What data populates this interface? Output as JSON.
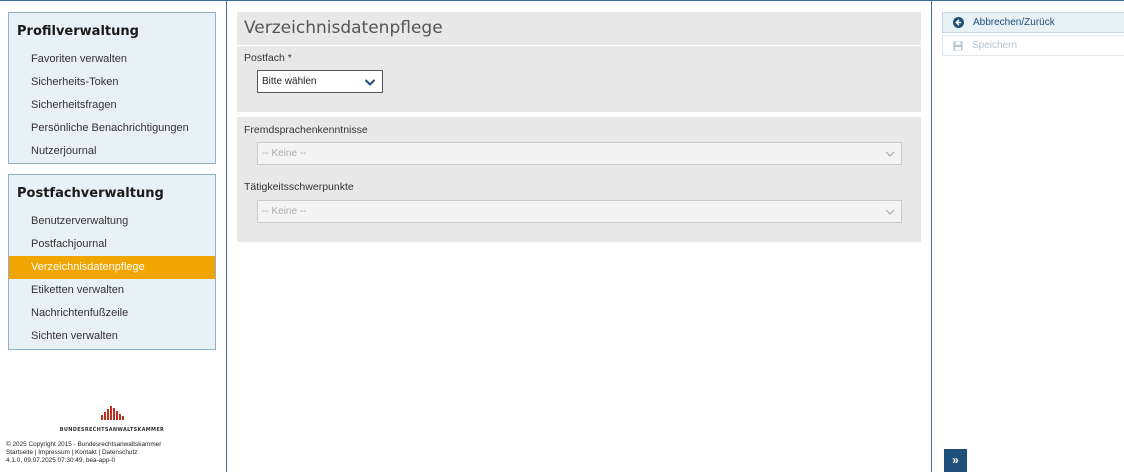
{
  "sidebar": {
    "profile": {
      "title": "Profilverwaltung",
      "items": [
        {
          "label": "Favoriten verwalten"
        },
        {
          "label": "Sicherheits-Token"
        },
        {
          "label": "Sicherheitsfragen"
        },
        {
          "label": "Persönliche Benachrichtigungen"
        },
        {
          "label": "Nutzerjournal"
        }
      ]
    },
    "mailbox": {
      "title": "Postfachverwaltung",
      "items": [
        {
          "label": "Benutzerverwaltung"
        },
        {
          "label": "Postfachjournal"
        },
        {
          "label": "Verzeichnisdatenpflege",
          "active": true
        },
        {
          "label": "Etiketten verwalten"
        },
        {
          "label": "Nachrichtenfußzeile"
        },
        {
          "label": "Sichten verwalten"
        }
      ]
    },
    "logo_text": "BUNDESRECHTSANWALTSKAMMER",
    "footer": {
      "copyright": "© 2025 Copyright 2015 - Bundesrechtsanwaltskammer",
      "links": [
        "Startseite",
        "Impressum",
        "Kontakt",
        "Datenschutz"
      ],
      "separator": " | ",
      "version": "4.1.0, 09.07.2025 07:30:49, bea-app-0"
    }
  },
  "main": {
    "title": "Verzeichnisdatenpflege",
    "postfach": {
      "label": "Postfach *",
      "value": "Bitte wählen"
    },
    "languages": {
      "label": "Fremdsprachenkenntnisse",
      "value": "-- Keine --"
    },
    "focus": {
      "label": "Tätigkeitsschwerpunkte",
      "value": "-- Keine --"
    }
  },
  "actions": {
    "back_label": "Abbrechen/Zurück",
    "save_label": "Speichern",
    "expand_label": "»"
  },
  "colors": {
    "accent": "#f0a500",
    "primary": "#1f4e79",
    "border": "#3a6ea5",
    "panel_bg": "#e8f1f5"
  }
}
